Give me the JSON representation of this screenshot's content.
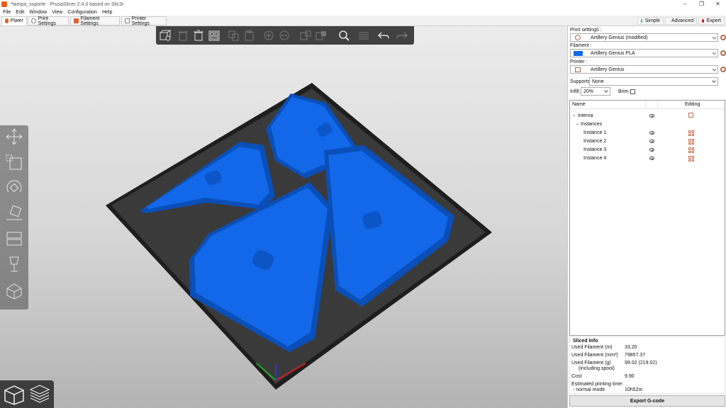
{
  "window": {
    "title": "*tampa_suporte - PrusaSlicer-2.4.0 based on Slic3r",
    "controls": [
      "–",
      "❐",
      "✕"
    ]
  },
  "menu": [
    "File",
    "Edit",
    "Window",
    "View",
    "Configuration",
    "Help"
  ],
  "tabs": [
    {
      "label": "Plater",
      "icon": "plater-icon"
    },
    {
      "label": "Print Settings",
      "icon": "print-settings-icon"
    },
    {
      "label": "Filament Settings",
      "icon": "filament-icon"
    },
    {
      "label": "Printer Settings",
      "icon": "printer-icon"
    }
  ],
  "modes": [
    {
      "label": "Simple",
      "color": "#38c638"
    },
    {
      "label": "Advanced",
      "color": "#e8c21a"
    },
    {
      "label": "Expert",
      "color": "#d60a0a"
    }
  ],
  "colors": {
    "model": "#1268e8",
    "model_dark": "#0a4fb8",
    "bed": "#3a3a3a",
    "toolbar": "#414141",
    "accent": "#b06b48"
  },
  "toolbar_icons": [
    "add-icon",
    "delete-icon",
    "delete-all-icon",
    "arrange-icon",
    "copy-icon",
    "paste-icon",
    "add-instance-icon",
    "remove-instance-icon",
    "split-objects-icon",
    "split-parts-icon",
    "search-icon",
    "layers-editing-icon",
    "undo-icon",
    "redo-icon"
  ],
  "gizmo_icons": [
    "move-icon",
    "scale-icon",
    "rotate-icon",
    "place-on-face-icon",
    "cut-icon",
    "supports-paint-icon",
    "seam-paint-icon",
    "simplify-icon"
  ],
  "sidebar": {
    "print_settings_label": "Print settings :",
    "print_settings_value": "Artillery Genius (modified)",
    "filament_label": "Filament :",
    "filament_value": "Artillery Genius PLA",
    "printer_label": "Printer :",
    "printer_value": "Artillery Genius",
    "supports_label": "Supports:",
    "supports_value": "None",
    "infill_label": "Infill:",
    "infill_value": "20%",
    "brim_label": "Brim:"
  },
  "object_list": {
    "col_name": "Name",
    "col_editing": "Editing",
    "object": "interna",
    "instances_label": "Instances",
    "instances": [
      "Instance 1",
      "Instance 2",
      "Instance 3",
      "Instance 4"
    ]
  },
  "sliced_info": {
    "title": "Sliced Info",
    "rows": [
      {
        "label": "Used Filament (m)",
        "value": "33.20"
      },
      {
        "label": "Used Filament (mm³)",
        "value": "79857.37"
      },
      {
        "label": "Used Filament (g)",
        "sub": "(including spool)",
        "value": "99.02 (219.02)"
      },
      {
        "label": "Cost",
        "value": "9.90"
      }
    ],
    "time_label": "Estimated printing time:",
    "time_mode": "- normal mode",
    "time_value": "10h52m"
  },
  "export_label": "Export G-code"
}
